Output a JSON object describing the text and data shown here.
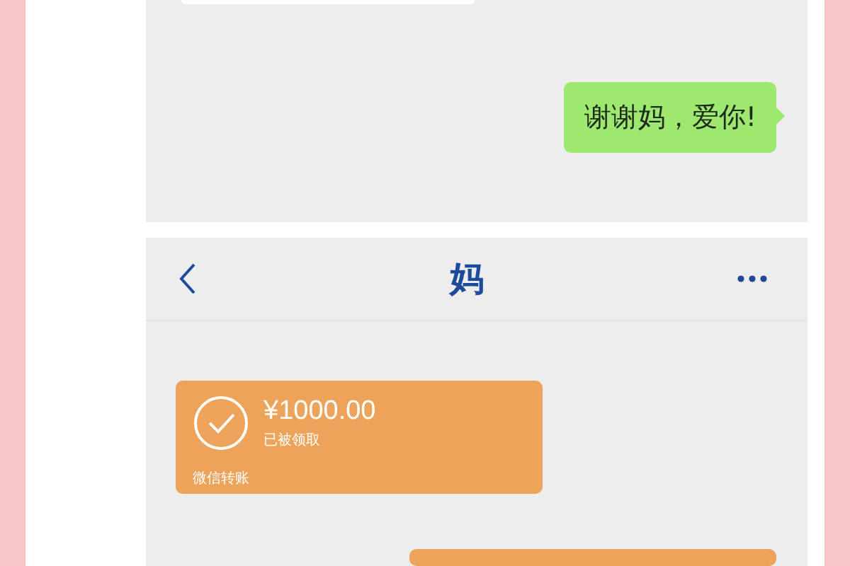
{
  "top_chat": {
    "messages": [
      {
        "kind": "text",
        "outgoing": false
      },
      {
        "kind": "text",
        "outgoing": true,
        "text": "谢谢妈，爱你!"
      }
    ]
  },
  "bottom_chat": {
    "header": {
      "title": "妈"
    },
    "messages": [
      {
        "kind": "transfer",
        "outgoing": false,
        "amount": "¥1000.00",
        "status": "已被领取",
        "footer": "微信转账"
      },
      {
        "kind": "transfer",
        "outgoing": true
      }
    ]
  }
}
